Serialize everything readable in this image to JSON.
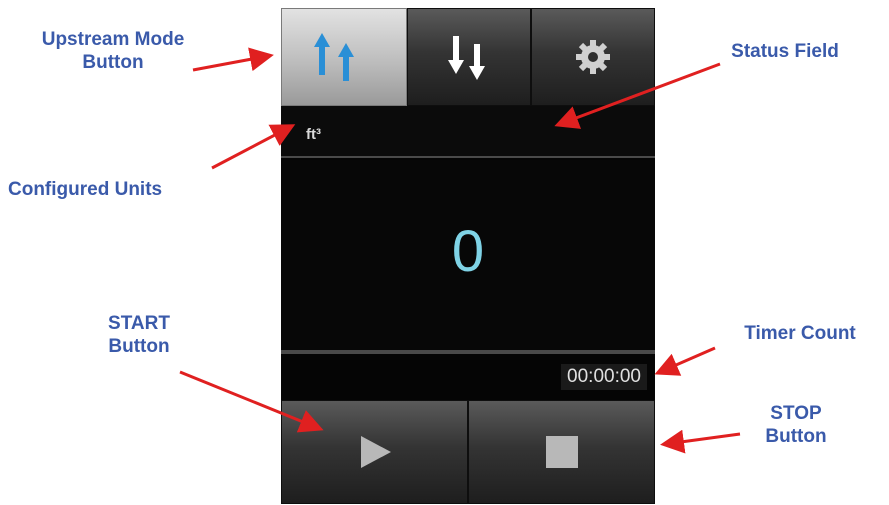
{
  "screen": {
    "units": "ft³",
    "value": "0",
    "timer": "00:00:00"
  },
  "buttons": {
    "upstream_icon": "upstream-arrows-icon",
    "downstream_icon": "downstream-arrows-icon",
    "settings_icon": "gear-icon",
    "start_icon": "play-icon",
    "stop_icon": "stop-icon"
  },
  "callouts": {
    "upstream_line1": "Upstream Mode",
    "upstream_line2": "Button",
    "status_field": "Status Field",
    "configured_units": "Configured Units",
    "start_line1": "START",
    "start_line2": "Button",
    "timer_count": "Timer Count",
    "stop_line1": "STOP",
    "stop_line2": "Button"
  },
  "colors": {
    "callout_text": "#3a5aaa",
    "arrow": "#e02020",
    "value_text": "#7fd3e6"
  }
}
